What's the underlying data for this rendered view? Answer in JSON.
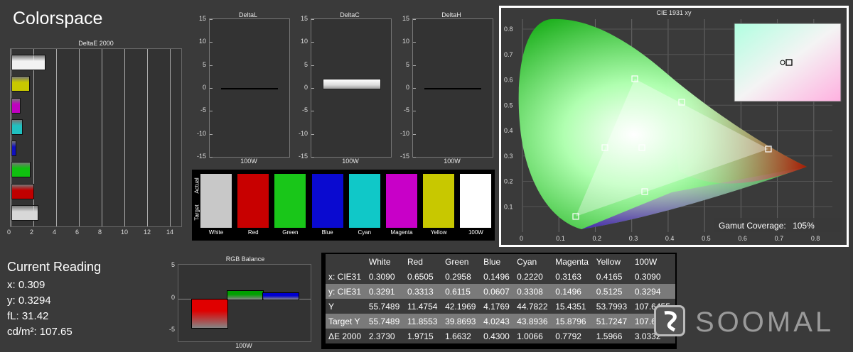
{
  "title": "Colorspace",
  "deltae_chart": {
    "title": "DeltaE 2000",
    "xticks": [
      "0",
      "2",
      "4",
      "6",
      "8",
      "10",
      "12",
      "14"
    ],
    "bars": [
      {
        "name": "White",
        "value": 3.0,
        "color": "#f2f2f2"
      },
      {
        "name": "Yellow",
        "value": 1.6,
        "color": "#c8c800"
      },
      {
        "name": "Magenta",
        "value": 0.8,
        "color": "#c000c0"
      },
      {
        "name": "Cyan",
        "value": 1.0,
        "color": "#20c0c0"
      },
      {
        "name": "Blue",
        "value": 0.43,
        "color": "#1010c0"
      },
      {
        "name": "Green",
        "value": 1.66,
        "color": "#10c010"
      },
      {
        "name": "Red",
        "value": 1.97,
        "color": "#c00000"
      },
      {
        "name": "Gray",
        "value": 2.37,
        "color": "#d8d8d8"
      }
    ]
  },
  "delta_panels": [
    {
      "title": "DeltaL",
      "xlabel": "100W",
      "value": 0
    },
    {
      "title": "DeltaC",
      "xlabel": "100W",
      "value": 2
    },
    {
      "title": "DeltaH",
      "xlabel": "100W",
      "value": 0
    }
  ],
  "delta_ticks": [
    "15",
    "10",
    "5",
    "0",
    "-5",
    "-10",
    "-15"
  ],
  "swatches": {
    "row_actual": "Actual",
    "row_target": "Target",
    "items": [
      {
        "label": "White",
        "color": "#c8c8c8"
      },
      {
        "label": "Red",
        "color": "#c80000"
      },
      {
        "label": "Green",
        "color": "#19c619"
      },
      {
        "label": "Blue",
        "color": "#0a0ad0"
      },
      {
        "label": "Cyan",
        "color": "#10c8c8"
      },
      {
        "label": "Magenta",
        "color": "#c800c8"
      },
      {
        "label": "Yellow",
        "color": "#c8c800"
      },
      {
        "label": "100W",
        "color": "#ffffff"
      }
    ]
  },
  "cie": {
    "title": "CIE 1931 xy",
    "xticks": [
      "0",
      "0.1",
      "0.2",
      "0.3",
      "0.4",
      "0.5",
      "0.6",
      "0.7",
      "0.8"
    ],
    "yticks": [
      "0.8",
      "0.7",
      "0.6",
      "0.5",
      "0.4",
      "0.3",
      "0.2",
      "0.1"
    ],
    "gamut_label": "Gamut Coverage:",
    "gamut_value": "105%"
  },
  "current_reading": {
    "heading": "Current Reading",
    "x": "x: 0.309",
    "y": "y: 0.3294",
    "fl": "fL: 31.42",
    "cd": "cd/m²: 107.65"
  },
  "rgb_balance": {
    "title": "RGB Balance",
    "xlabel": "100W",
    "yticks": [
      "5",
      "0",
      "-5"
    ],
    "values": [
      {
        "name": "R",
        "value": -4.5,
        "color": "#e00000"
      },
      {
        "name": "G",
        "value": 1.3,
        "color": "#00a000"
      },
      {
        "name": "B",
        "value": 0.9,
        "color": "#0000d0"
      }
    ]
  },
  "table": {
    "headers": [
      "",
      "White",
      "Red",
      "Green",
      "Blue",
      "Cyan",
      "Magenta",
      "Yellow",
      "100W"
    ],
    "rows": [
      [
        "x: CIE31",
        "0.3090",
        "0.6505",
        "0.2958",
        "0.1496",
        "0.2220",
        "0.3163",
        "0.4165",
        "0.3090"
      ],
      [
        "y: CIE31",
        "0.3291",
        "0.3313",
        "0.6115",
        "0.0607",
        "0.3308",
        "0.1496",
        "0.5125",
        "0.3294"
      ],
      [
        "Y",
        "55.7489",
        "11.4754",
        "42.1969",
        "4.1769",
        "44.7822",
        "15.4351",
        "53.7993",
        "107.6455"
      ],
      [
        "Target Y",
        "55.7489",
        "11.8553",
        "39.8693",
        "4.0243",
        "43.8936",
        "15.8796",
        "51.7247",
        "107.6455"
      ],
      [
        "ΔE 2000",
        "2.3730",
        "1.9715",
        "1.6632",
        "0.4300",
        "1.0066",
        "0.7792",
        "1.5966",
        "3.0332"
      ]
    ]
  },
  "watermark": "SOOMAL"
}
